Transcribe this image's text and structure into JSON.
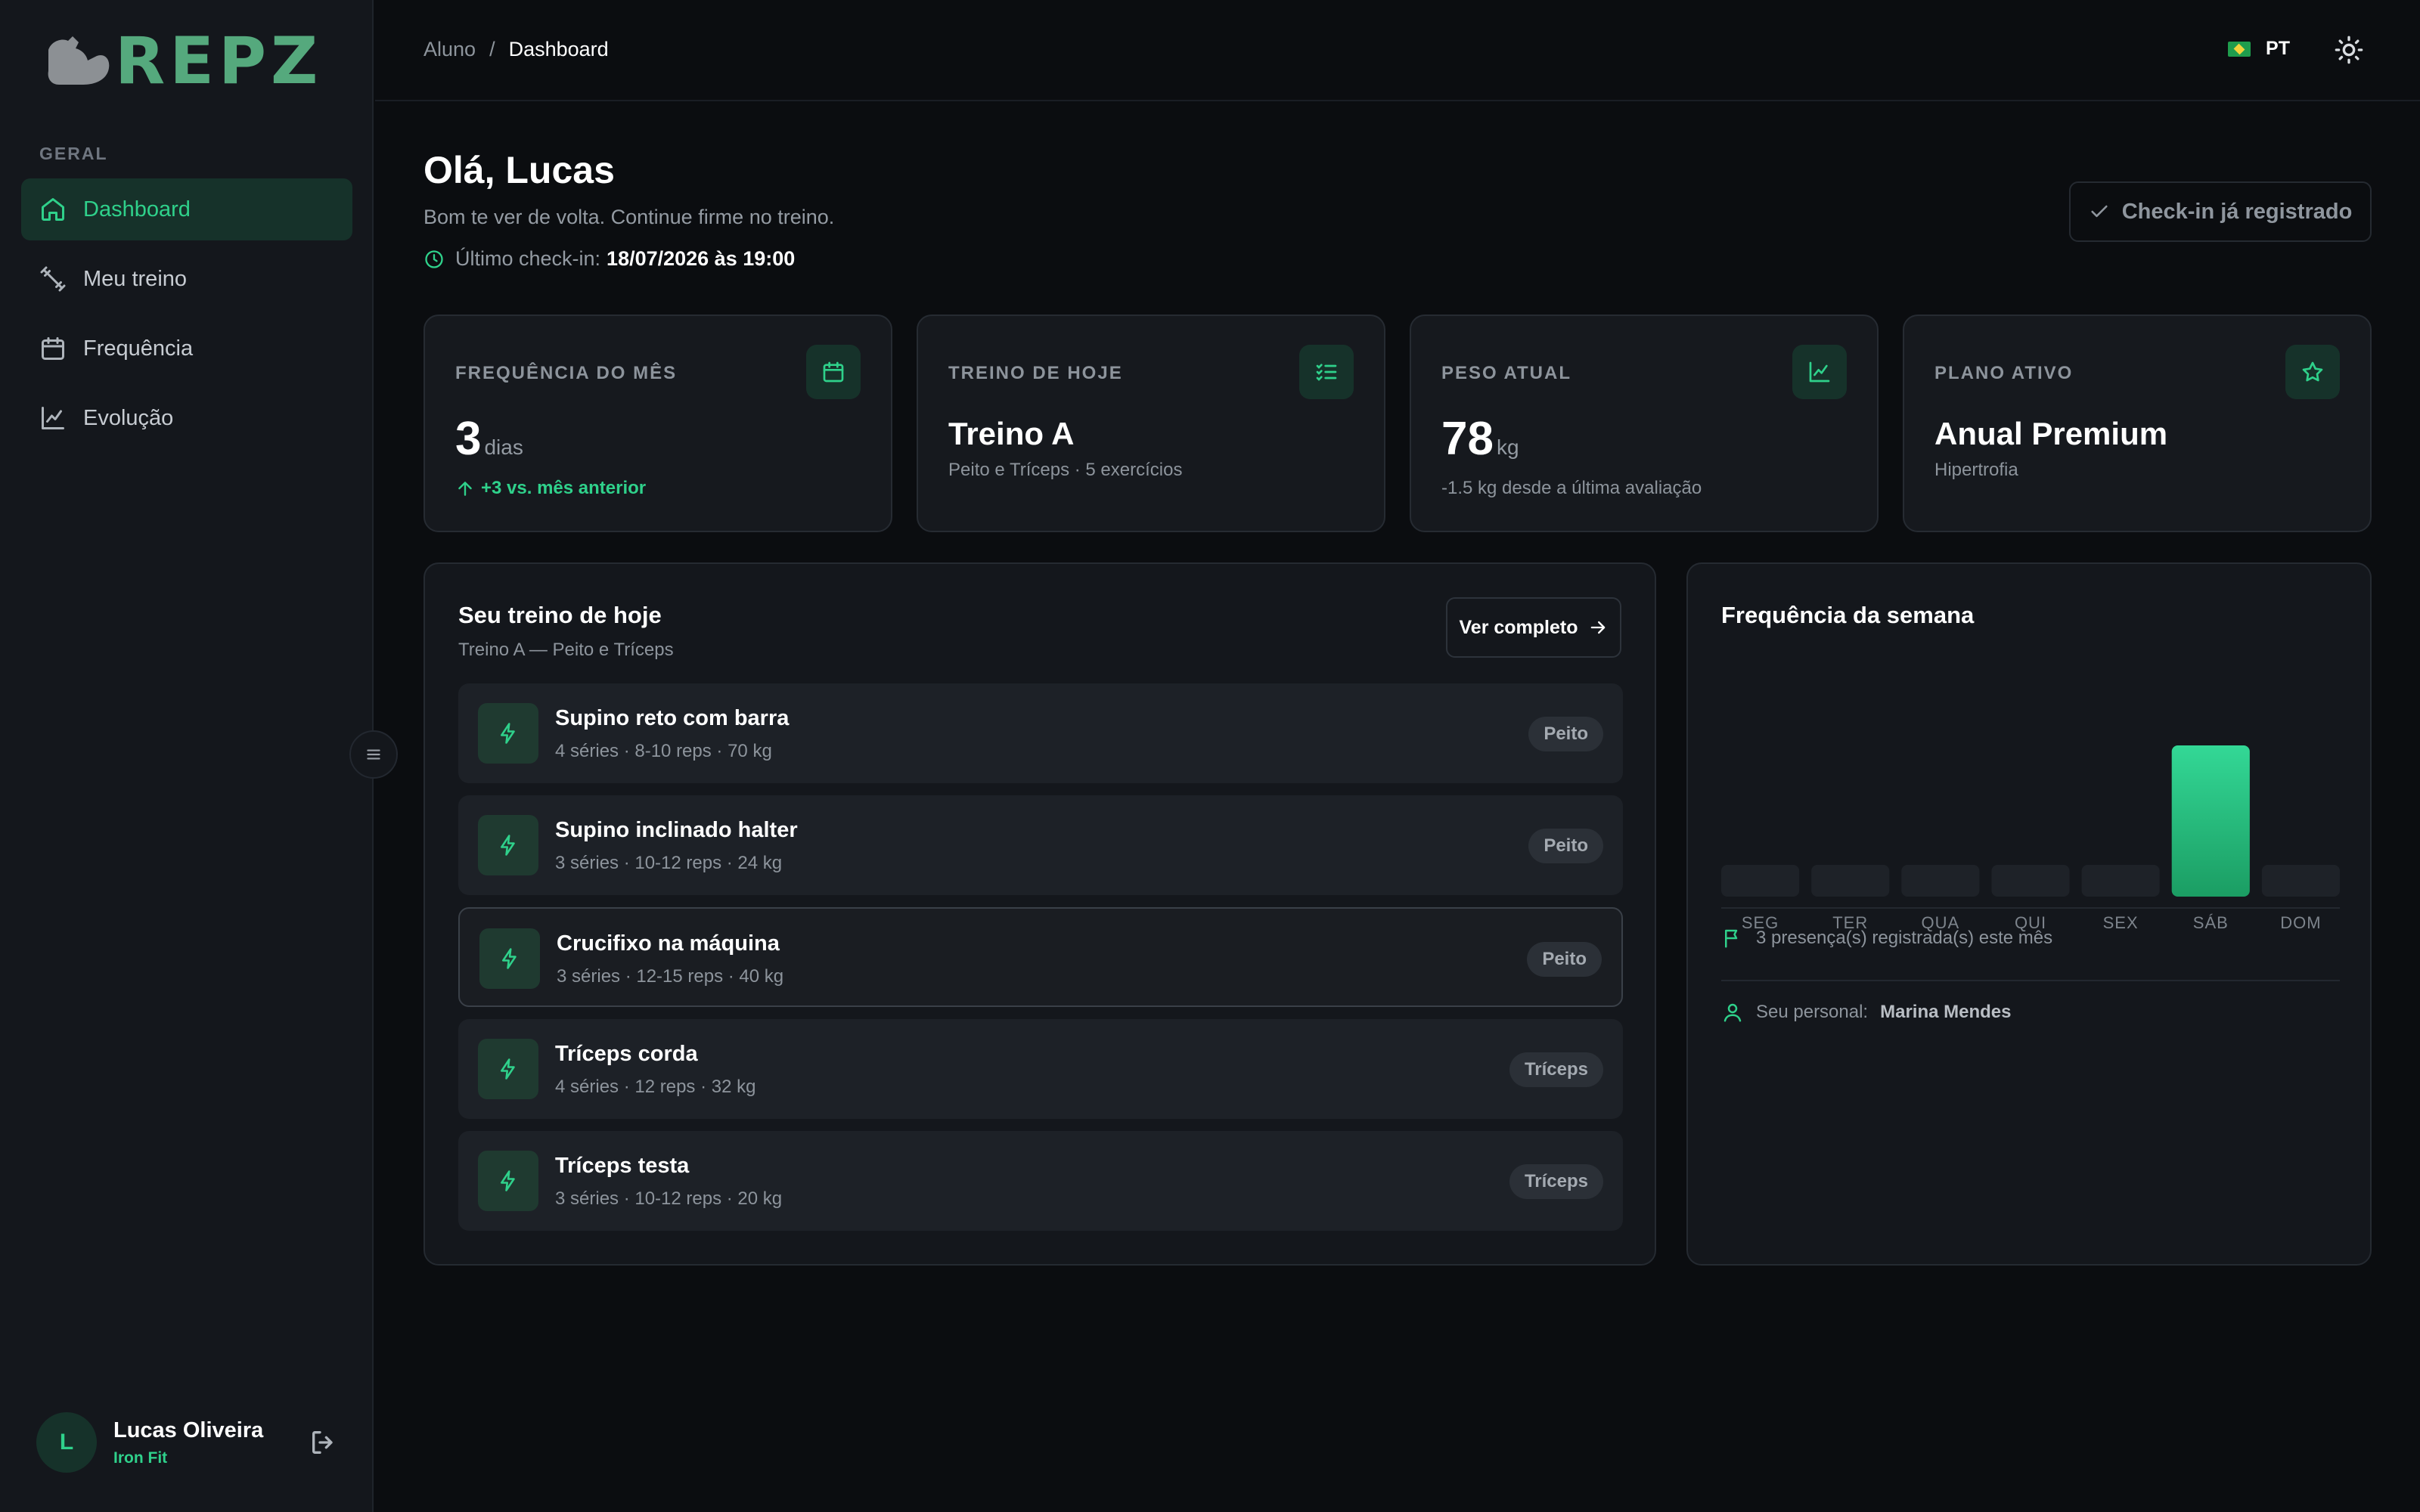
{
  "brand": {
    "name": "REPZ"
  },
  "sidebar": {
    "section": "GERAL",
    "items": [
      {
        "label": "Dashboard",
        "icon": "home-icon"
      },
      {
        "label": "Meu treino",
        "icon": "dumbbell-icon"
      },
      {
        "label": "Frequência",
        "icon": "calendar-icon"
      },
      {
        "label": "Evolução",
        "icon": "chart-icon"
      }
    ]
  },
  "user": {
    "initial": "L",
    "name": "Lucas Oliveira",
    "org": "Iron Fit"
  },
  "breadcrumb": {
    "parent": "Aluno",
    "separator": "/",
    "current": "Dashboard"
  },
  "header": {
    "lang": "PT"
  },
  "greeting": {
    "title": "Olá, Lucas",
    "subtitle": "Bom te ver de volta. Continue firme no treino.",
    "last_label": "Último check-in:",
    "last_value": "18/07/2026 às 19:00"
  },
  "checkin": {
    "label": "Check-in já registrado"
  },
  "stats": [
    {
      "label": "FREQUÊNCIA DO MÊS",
      "value": "3",
      "unit": "dias",
      "delta": "+3 vs. mês anterior"
    },
    {
      "label": "TREINO DE HOJE",
      "title": "Treino A",
      "desc": "Peito e Tríceps · 5 exercícios"
    },
    {
      "label": "PESO ATUAL",
      "value": "78",
      "unit": "kg",
      "desc": "-1.5 kg desde a última avaliação"
    },
    {
      "label": "PLANO ATIVO",
      "title": "Anual Premium",
      "desc": "Hipertrofia"
    }
  ],
  "workout": {
    "title": "Seu treino de hoje",
    "subtitle": "Treino A — Peito e Tríceps",
    "button": "Ver completo",
    "exercises": [
      {
        "name": "Supino reto com barra",
        "detail": "4 séries · 8-10 reps · 70 kg",
        "tag": "Peito"
      },
      {
        "name": "Supino inclinado halter",
        "detail": "3 séries · 10-12 reps · 24 kg",
        "tag": "Peito"
      },
      {
        "name": "Crucifixo na máquina",
        "detail": "3 séries · 12-15 reps · 40 kg",
        "tag": "Peito"
      },
      {
        "name": "Tríceps corda",
        "detail": "4 séries · 12 reps · 32 kg",
        "tag": "Tríceps"
      },
      {
        "name": "Tríceps testa",
        "detail": "3 séries · 10-12 reps · 20 kg",
        "tag": "Tríceps"
      }
    ]
  },
  "frequency": {
    "title": "Frequência da semana",
    "presences": "3 presença(s) registrada(s) este mês",
    "personal_label": "Seu personal:",
    "personal_name": "Marina Mendes"
  },
  "chart_data": {
    "type": "bar",
    "categories": [
      "SEG",
      "TER",
      "QUA",
      "QUI",
      "SEX",
      "SÁB",
      "DOM"
    ],
    "values": [
      0,
      0,
      0,
      0,
      0,
      1,
      0
    ],
    "ylim": [
      0,
      1
    ],
    "grid": false
  },
  "colors": {
    "accent": "#2fd18b",
    "background": "#0b0d10",
    "card": "#16191e"
  }
}
